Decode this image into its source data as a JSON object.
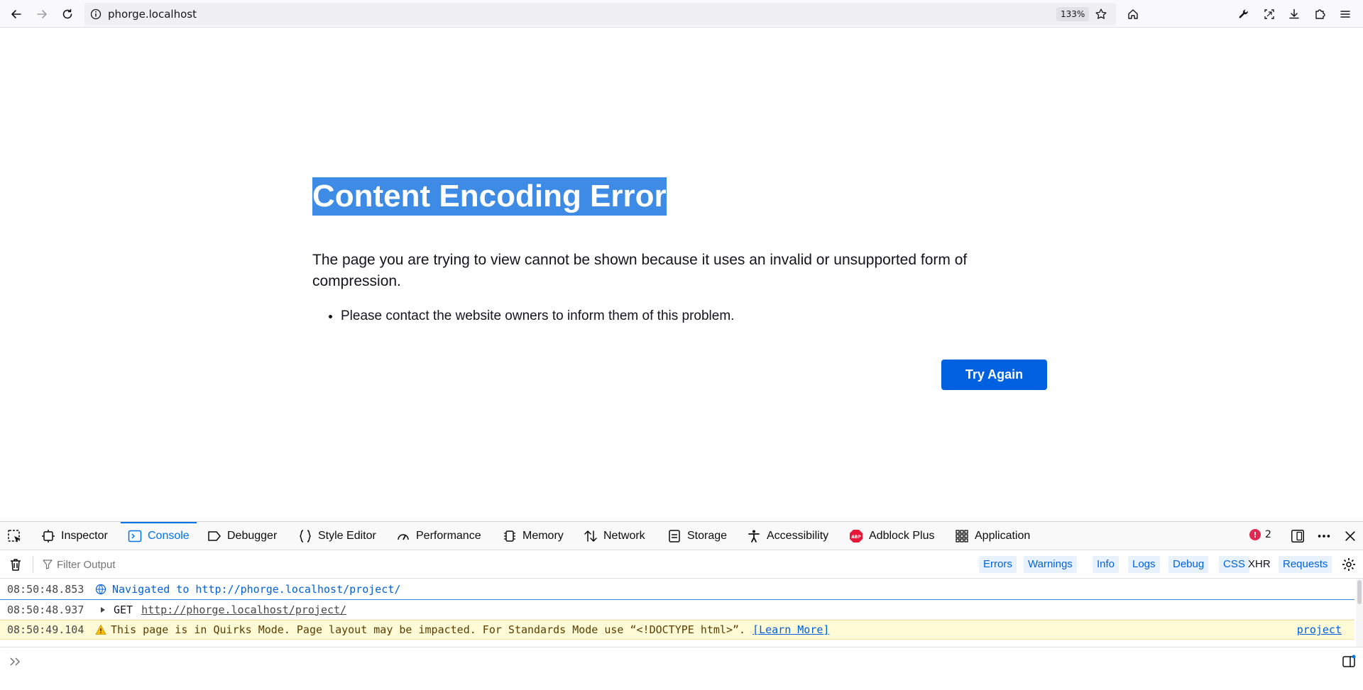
{
  "browser": {
    "url": "phorge.localhost",
    "zoom": "133%"
  },
  "error_page": {
    "title": "Content Encoding Error",
    "description": "The page you are trying to view cannot be shown because it uses an invalid or unsupported form of compression.",
    "bullets": [
      "Please contact the website owners to inform them of this problem."
    ],
    "button": "Try Again"
  },
  "devtools": {
    "tabs": [
      {
        "label": "Inspector",
        "icon": "inspector-icon"
      },
      {
        "label": "Console",
        "icon": "console-icon",
        "selected": true
      },
      {
        "label": "Debugger",
        "icon": "debugger-icon"
      },
      {
        "label": "Style Editor",
        "icon": "style-editor-icon"
      },
      {
        "label": "Performance",
        "icon": "performance-icon"
      },
      {
        "label": "Memory",
        "icon": "memory-icon"
      },
      {
        "label": "Network",
        "icon": "network-icon"
      },
      {
        "label": "Storage",
        "icon": "storage-icon"
      },
      {
        "label": "Accessibility",
        "icon": "accessibility-icon"
      },
      {
        "label": "Adblock Plus",
        "icon": "adblock-plus-icon"
      },
      {
        "label": "Application",
        "icon": "application-icon"
      }
    ],
    "error_count": "2",
    "filter_placeholder": "Filter Output",
    "levels": [
      {
        "label": "Errors",
        "active": true
      },
      {
        "label": "Warnings",
        "active": true
      },
      {
        "label": "Info",
        "active": true
      },
      {
        "label": "Logs",
        "active": true
      },
      {
        "label": "Debug",
        "active": true
      },
      {
        "label": "CSS",
        "active": true
      },
      {
        "label": "XHR",
        "active": false
      },
      {
        "label": "Requests",
        "active": true
      }
    ],
    "log": [
      {
        "kind": "navigation",
        "time": "08:50:48.853",
        "text": "Navigated to http://phorge.localhost/project/"
      },
      {
        "kind": "request",
        "time": "08:50:48.937",
        "method": "GET",
        "url": "http://phorge.localhost/project/"
      },
      {
        "kind": "warning",
        "time": "08:50:49.104",
        "text": "This page is in Quirks Mode. Page layout may be impacted. For Standards Mode use “<!DOCTYPE html>”.",
        "link": "[Learn More]",
        "source": "project"
      }
    ]
  },
  "colors": {
    "accent": "#0061e0",
    "selection": "#3d8be4",
    "warning_bg": "#fffbd6",
    "error_badge": "#e22850"
  }
}
